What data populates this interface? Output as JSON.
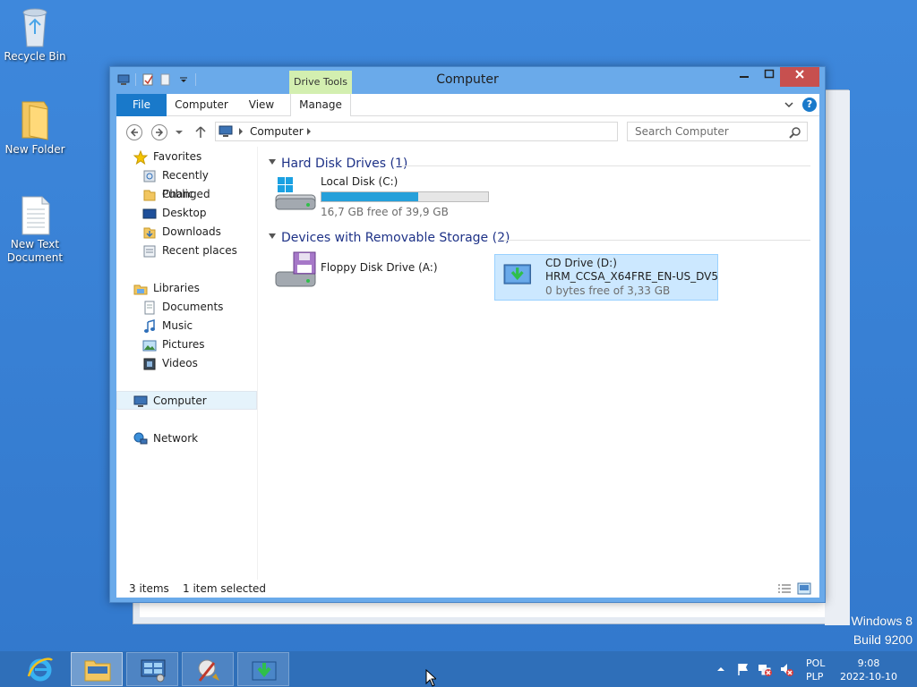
{
  "desktop": {
    "icons": [
      {
        "label": "Recycle Bin",
        "icon": "recycle-bin-icon"
      },
      {
        "label": "New Folder",
        "icon": "folder-icon"
      },
      {
        "label": "New Text Document",
        "icon": "text-document-icon"
      }
    ],
    "watermark": {
      "line1": "Windows 8",
      "line2": "Build 9200"
    }
  },
  "window": {
    "title": "Computer",
    "context_tab": "Drive Tools",
    "ribbon_tabs": [
      "File",
      "Computer",
      "View",
      "Manage"
    ],
    "help_label": "?",
    "address": {
      "crumb": "Computer"
    },
    "search": {
      "placeholder": "Search Computer"
    },
    "nav": {
      "favorites": "Favorites",
      "favorites_items": [
        "Recently Changed",
        "Public",
        "Desktop",
        "Downloads",
        "Recent places"
      ],
      "libraries": "Libraries",
      "libraries_items": [
        "Documents",
        "Music",
        "Pictures",
        "Videos"
      ],
      "computer": "Computer",
      "network": "Network"
    },
    "groups": {
      "hdd": "Hard Disk Drives (1)",
      "removable": "Devices with Removable Storage (2)"
    },
    "drives": {
      "c": {
        "name": "Local Disk (C:)",
        "free": "16,7 GB free of 39,9 GB",
        "used_fraction": 0.58
      },
      "a": {
        "name": "Floppy Disk Drive (A:)"
      },
      "d": {
        "name": "CD Drive (D:)",
        "label": "HRM_CCSA_X64FRE_EN-US_DV5",
        "free": "0 bytes free of 3,33 GB"
      }
    },
    "status": {
      "items": "3 items",
      "selected": "1 item selected"
    }
  },
  "taskbar": {
    "apps": [
      "internet-explorer",
      "file-explorer",
      "control-panel",
      "disk-cleanup",
      "installer"
    ],
    "lang": {
      "line1": "POL",
      "line2": "PLP"
    },
    "clock": {
      "time": "9:08",
      "date": "2022-10-10"
    }
  },
  "colors": {
    "desktop": "#3a83d6",
    "file_tab": "#1979ca",
    "context_tab": "#d3efb0",
    "close": "#c7504f",
    "bar": "#26a0da",
    "group_header": "#1e3287"
  }
}
